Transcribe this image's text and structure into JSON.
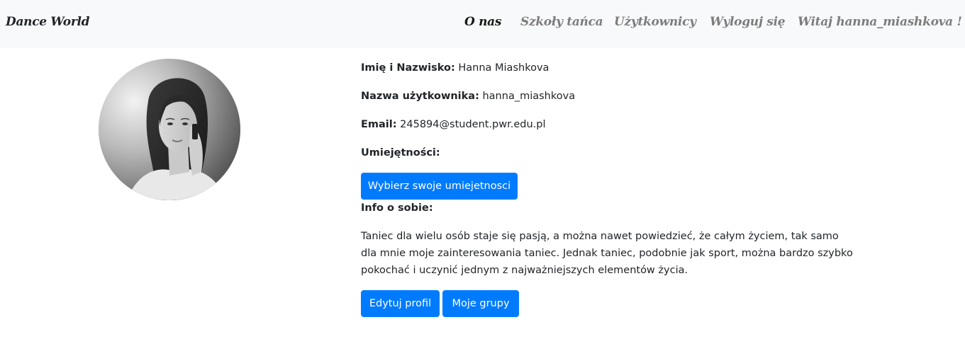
{
  "navbar": {
    "brand": "Dance World",
    "links": [
      {
        "label": "O nas",
        "active": true
      },
      {
        "label": "Szkoły tańca",
        "active": false
      },
      {
        "label": "Użytkownicy",
        "active": false
      },
      {
        "label": "Wyloguj się",
        "active": false
      },
      {
        "label": "Witaj hanna_miashkova !",
        "active": false
      }
    ]
  },
  "profile": {
    "name_label": "Imię i Nazwisko:",
    "name_value": "Hanna Miashkova",
    "username_label": "Nazwa użytkownika:",
    "username_value": "hanna_miashkova",
    "email_label": "Email:",
    "email_value": "245894@student.pwr.edu.pl",
    "skills_label": "Umiejętności:",
    "skills_button": "Wybierz swoje umiejetnosci",
    "about_label": "Info o sobie:",
    "about_text": "Taniec dla wielu osób staje się pasją, a można nawet powiedzieć, że całym życiem, tak samo dla mnie moje zainteresowania taniec. Jednak taniec, podobnie jak sport, można bardzo szybko pokochać i uczynić jednym z najważniejszych elementów życia.",
    "edit_button": "Edytuj profil",
    "groups_button": "Moje grupy"
  },
  "colors": {
    "primary": "#007bff",
    "navbar_bg": "#f8f9fa"
  }
}
